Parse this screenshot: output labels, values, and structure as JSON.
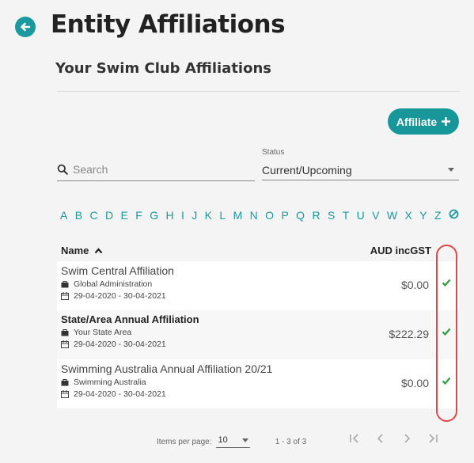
{
  "header": {
    "title": "Entity Affiliations",
    "subtitle": "Your Swim Club Affiliations"
  },
  "toolbar": {
    "affiliate_label": "Affiliate"
  },
  "filters": {
    "search_placeholder": "Search",
    "status_label": "Status",
    "status_value": "Current/Upcoming"
  },
  "alphabet": [
    "A",
    "B",
    "C",
    "D",
    "E",
    "F",
    "G",
    "H",
    "I",
    "J",
    "K",
    "L",
    "M",
    "N",
    "O",
    "P",
    "Q",
    "R",
    "S",
    "T",
    "U",
    "V",
    "W",
    "X",
    "Y",
    "Z"
  ],
  "table": {
    "col_name": "Name",
    "col_price": "AUD incGST",
    "rows": [
      {
        "name": "Swim Central Affiliation",
        "entity": "Global Administration",
        "dates": "29-04-2020 - 30-04-2021",
        "price": "$0.00"
      },
      {
        "name": "State/Area Annual Affiliation",
        "entity": "Your State Area",
        "dates": "29-04-2020 - 30-04-2021",
        "price": "$222.29"
      },
      {
        "name": "Swimming Australia Annual Affiliation 20/21",
        "entity": "Swimming Australia",
        "dates": "29-04-2020 - 30-04-2021",
        "price": "$0.00"
      }
    ]
  },
  "pager": {
    "per_page_label": "Items per page:",
    "per_page_value": "10",
    "range": "1 - 3 of 3"
  },
  "colors": {
    "accent": "#18979b",
    "highlight": "#e04848",
    "check": "#2e9e3e"
  }
}
